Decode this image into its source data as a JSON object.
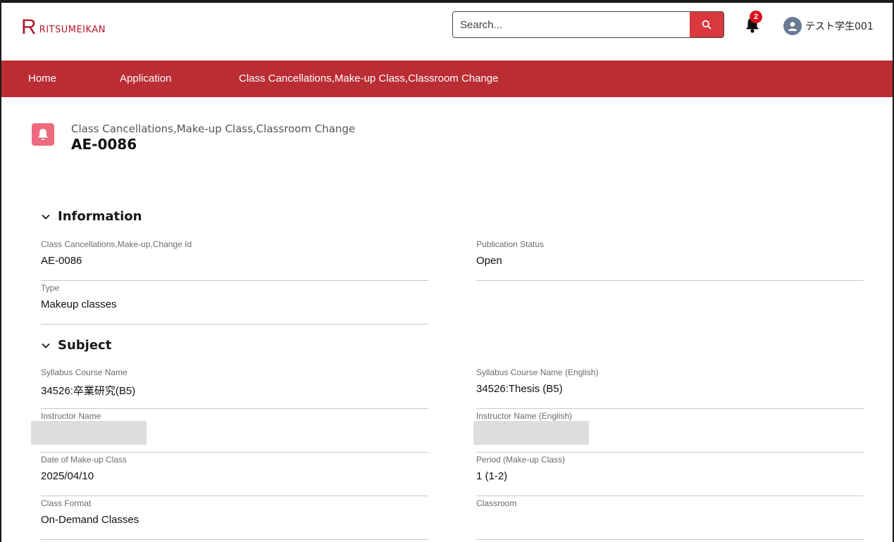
{
  "header": {
    "logo_mark": "R",
    "logo_text": "RITSUMEIKAN",
    "search_placeholder": "Search...",
    "notification_count": "2",
    "user_name": "テスト学生001"
  },
  "nav": {
    "items": [
      "Home",
      "Application",
      "Class Cancellations,Make-up Class,Classroom Change"
    ]
  },
  "record": {
    "object_label": "Class Cancellations,Make-up Class,Classroom Change",
    "title": "AE-0086",
    "icon": "bell-icon"
  },
  "sections": {
    "information": {
      "title": "Information",
      "fields": {
        "change_id": {
          "label": "Class Cancellations,Make-up,Change Id",
          "value": "AE-0086"
        },
        "publication_status": {
          "label": "Publication Status",
          "value": "Open"
        },
        "type": {
          "label": "Type",
          "value": "Makeup classes"
        }
      }
    },
    "subject": {
      "title": "Subject",
      "fields": {
        "course_name": {
          "label": "Syllabus Course Name",
          "value": "34526:卒業研究(B5)"
        },
        "course_name_en": {
          "label": "Syllabus Course Name (English)",
          "value": "34526:Thesis (B5)"
        },
        "instructor": {
          "label": "Instructor Name",
          "value": ""
        },
        "instructor_en": {
          "label": "Instructor Name (English)",
          "value": ""
        },
        "makeup_date": {
          "label": "Date of Make-up Class",
          "value": "2025/04/10"
        },
        "makeup_period": {
          "label": "Period (Make-up Class)",
          "value": "1 (1-2)"
        },
        "class_format": {
          "label": "Class Format",
          "value": "On-Demand Classes"
        },
        "classroom": {
          "label": "Classroom",
          "value": ""
        }
      }
    }
  },
  "colors": {
    "brand": "#b5162b",
    "navbar": "#ba2d33",
    "search_button": "#d9383e",
    "record_icon": "#ee6b7f"
  }
}
